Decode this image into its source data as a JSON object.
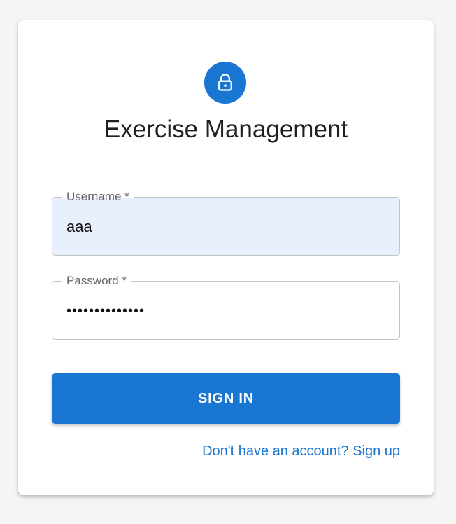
{
  "app": {
    "title": "Exercise Management",
    "accent_color": "#1976d2",
    "icon": "lock-icon"
  },
  "form": {
    "username": {
      "label": "Username *",
      "value": "aaa"
    },
    "password": {
      "label": "Password *",
      "value": "••••••••••••••"
    },
    "submit_label": "SIGN IN",
    "signup_link": "Don't have an account? Sign up"
  }
}
